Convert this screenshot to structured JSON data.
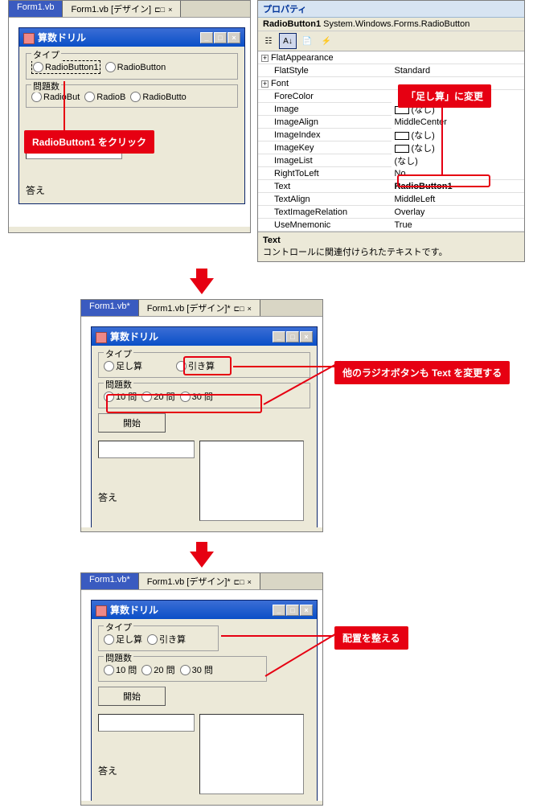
{
  "step1": {
    "designer": {
      "tabs": {
        "code": "Form1.vb",
        "design": "Form1.vb [デザイン]",
        "pin": "⊏□",
        "close": "×"
      },
      "form": {
        "title": "算数ドリル",
        "group_type": "タイプ",
        "radio1": "RadioButton1",
        "radio2": "RadioButton",
        "group_count": "問題数",
        "radioA": "RadioBut",
        "radioB": "RadioB",
        "radioC": "RadioButto",
        "answer": "答え"
      }
    },
    "callout1": "RadioButton1 をクリック"
  },
  "props": {
    "title": "プロパティ",
    "object": {
      "name": "RadioButton1",
      "type": "System.Windows.Forms.RadioButton"
    },
    "rows": [
      {
        "n": "FlatAppearance",
        "v": "",
        "exp": "+"
      },
      {
        "n": "FlatStyle",
        "v": "Standard"
      },
      {
        "n": "Font",
        "v": "",
        "exp": "+"
      },
      {
        "n": "ForeColor",
        "v": ""
      },
      {
        "n": "Image",
        "v": "(なし)",
        "sw": true
      },
      {
        "n": "ImageAlign",
        "v": "MiddleCenter"
      },
      {
        "n": "ImageIndex",
        "v": "(なし)",
        "sw": true
      },
      {
        "n": "ImageKey",
        "v": "(なし)",
        "sw": true
      },
      {
        "n": "ImageList",
        "v": "(なし)"
      },
      {
        "n": "RightToLeft",
        "v": "No"
      },
      {
        "n": "Text",
        "v": "RadioButton1",
        "sel": true
      },
      {
        "n": "TextAlign",
        "v": "MiddleLeft"
      },
      {
        "n": "TextImageRelation",
        "v": "Overlay"
      },
      {
        "n": "UseMnemonic",
        "v": "True"
      }
    ],
    "desc": {
      "name": "Text",
      "text": "コントロールに関連付けられたテキストです。"
    },
    "callout2": "「足し算」に変更"
  },
  "step2": {
    "designer": {
      "tabs": {
        "code": "Form1.vb*",
        "design": "Form1.vb [デザイン]*",
        "pin": "⊏□",
        "close": "×"
      },
      "form": {
        "title": "算数ドリル",
        "group_type": "タイプ",
        "radio1": "足し算",
        "radio2": "引き算",
        "group_count": "問題数",
        "radioA": "10 問",
        "radioB": "20 問",
        "radioC": "30 問",
        "start": "開始",
        "answer": "答え"
      }
    },
    "callout3": "他のラジオボタンも Text を変更する"
  },
  "step3": {
    "designer": {
      "tabs": {
        "code": "Form1.vb*",
        "design": "Form1.vb [デザイン]*",
        "pin": "⊏□",
        "close": "×"
      },
      "form": {
        "title": "算数ドリル",
        "group_type": "タイプ",
        "radio1": "足し算",
        "radio2": "引き算",
        "group_count": "問題数",
        "radioA": "10 問",
        "radioB": "20 問",
        "radioC": "30 問",
        "start": "開始",
        "answer": "答え"
      }
    },
    "callout4": "配置を整える"
  }
}
